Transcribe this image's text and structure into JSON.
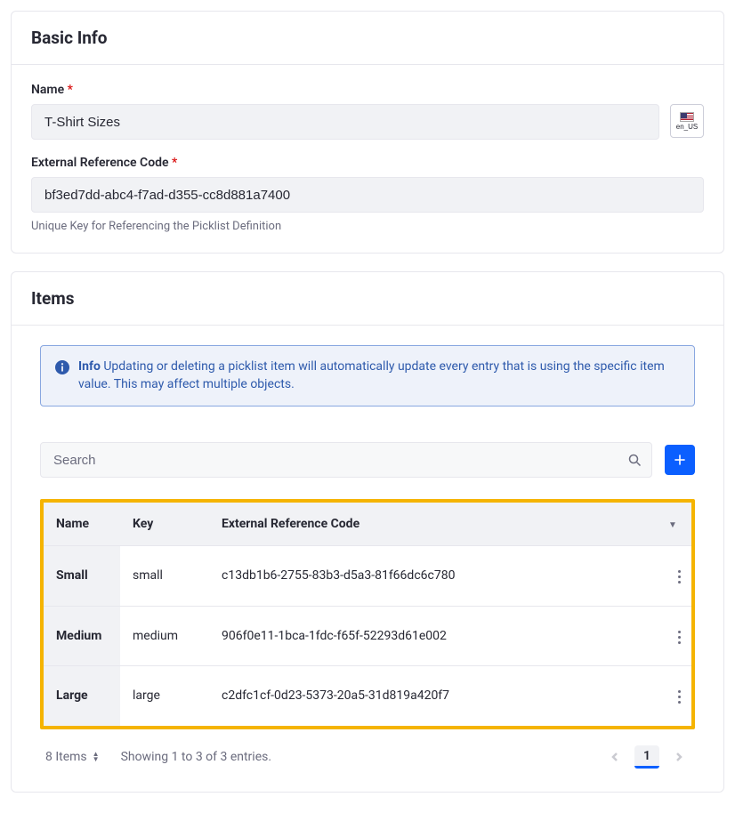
{
  "basic_info": {
    "title": "Basic Info",
    "name_label": "Name",
    "name_value": "T-Shirt Sizes",
    "locale_code": "en_US",
    "erc_label": "External Reference Code",
    "erc_value": "bf3ed7dd-abc4-f7ad-d355-cc8d881a7400",
    "erc_help": "Unique Key for Referencing the Picklist Definition"
  },
  "items": {
    "title": "Items",
    "info_prefix": "Info",
    "info_text": "Updating or deleting a picklist item will automatically update every entry that is using the specific item value. This may affect multiple objects.",
    "search_placeholder": "Search",
    "columns": {
      "name": "Name",
      "key": "Key",
      "erc": "External Reference Code"
    },
    "rows": [
      {
        "name": "Small",
        "key": "small",
        "erc": "c13db1b6-2755-83b3-d5a3-81f66dc6c780"
      },
      {
        "name": "Medium",
        "key": "medium",
        "erc": "906f0e11-1bca-1fdc-f65f-52293d61e002"
      },
      {
        "name": "Large",
        "key": "large",
        "erc": "c2dfc1cf-0d23-5373-20a5-31d819a420f7"
      }
    ],
    "pagination": {
      "count_text": "8 Items",
      "showing_text": "Showing 1 to 3 of 3 entries.",
      "page": "1"
    }
  }
}
